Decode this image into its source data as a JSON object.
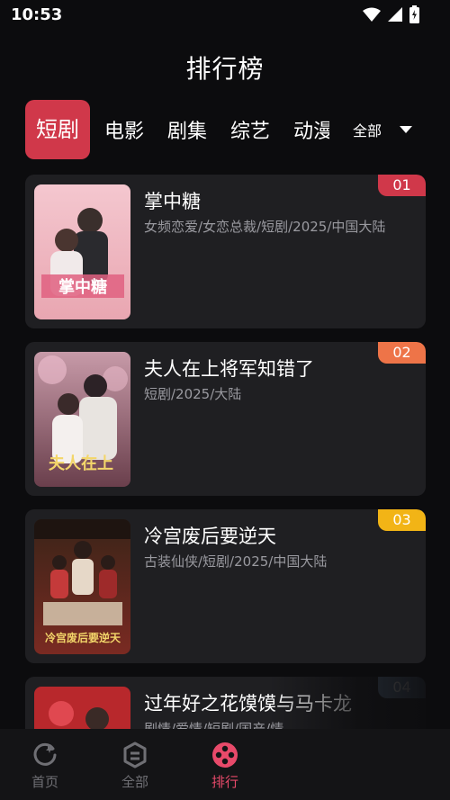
{
  "status": {
    "time": "10:53",
    "icons": [
      "wifi-icon",
      "signal-icon",
      "battery-charging-icon"
    ]
  },
  "page": {
    "title": "排行榜"
  },
  "tabs": [
    {
      "label": "短剧",
      "active": true
    },
    {
      "label": "电影",
      "active": false
    },
    {
      "label": "剧集",
      "active": false
    },
    {
      "label": "综艺",
      "active": false
    },
    {
      "label": "动漫",
      "active": false
    }
  ],
  "filter": {
    "label": "全部"
  },
  "items": [
    {
      "rank": "01",
      "rank_color": "#d0384a",
      "title": "掌中糖",
      "meta": "女频恋爱/女恋总裁/短剧/2025/中国大陆",
      "poster_text": "掌中糖"
    },
    {
      "rank": "02",
      "rank_color": "#ee7448",
      "title": "夫人在上将军知错了",
      "meta": "短剧/2025/大陆",
      "poster_text": "夫人在上"
    },
    {
      "rank": "03",
      "rank_color": "#f2b416",
      "title": "冷宫废后要逆天",
      "meta": "古装仙侠/短剧/2025/中国大陆",
      "poster_text": "冷宫废后要逆天"
    },
    {
      "rank": "04",
      "rank_color": "#6f8aa8",
      "title": "过年好之花馍馍与马卡龙",
      "meta": "剧情/爱情/短剧/国产/情",
      "poster_text": ""
    }
  ],
  "nav": [
    {
      "label": "首页",
      "icon": "home-icon",
      "active": false
    },
    {
      "label": "全部",
      "icon": "all-icon",
      "active": false
    },
    {
      "label": "排行",
      "icon": "rank-icon",
      "active": true
    }
  ],
  "colors": {
    "accent": "#d0384a",
    "nav_active": "#e84a6a",
    "card_bg": "#1f1f22",
    "bg": "#0c0c0e"
  }
}
